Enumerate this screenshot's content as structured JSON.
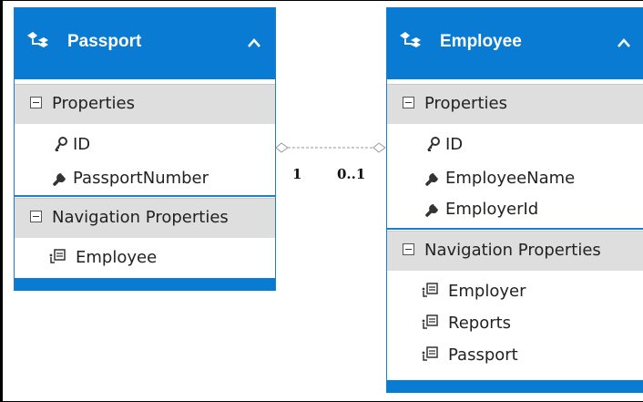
{
  "entities": [
    {
      "name": "Passport",
      "sections": [
        {
          "label": "Properties",
          "items": [
            {
              "kind": "key",
              "label": "ID"
            },
            {
              "kind": "wrench",
              "label": "PassportNumber"
            }
          ]
        },
        {
          "label": "Navigation Properties",
          "items": [
            {
              "kind": "nav",
              "label": "Employee"
            }
          ]
        }
      ]
    },
    {
      "name": "Employee",
      "sections": [
        {
          "label": "Properties",
          "items": [
            {
              "kind": "key",
              "label": "ID"
            },
            {
              "kind": "wrench",
              "label": "EmployeeName"
            },
            {
              "kind": "wrench",
              "label": "EmployerId"
            }
          ]
        },
        {
          "label": "Navigation Properties",
          "items": [
            {
              "kind": "nav",
              "label": "Employer"
            },
            {
              "kind": "nav",
              "label": "Reports"
            },
            {
              "kind": "nav",
              "label": "Passport"
            }
          ]
        }
      ]
    }
  ],
  "association": {
    "left_multiplicity": "1",
    "right_multiplicity": "0..1"
  },
  "colors": {
    "header": "#0a7bd2",
    "section": "#dedede",
    "connector": "#9a9a9a"
  }
}
